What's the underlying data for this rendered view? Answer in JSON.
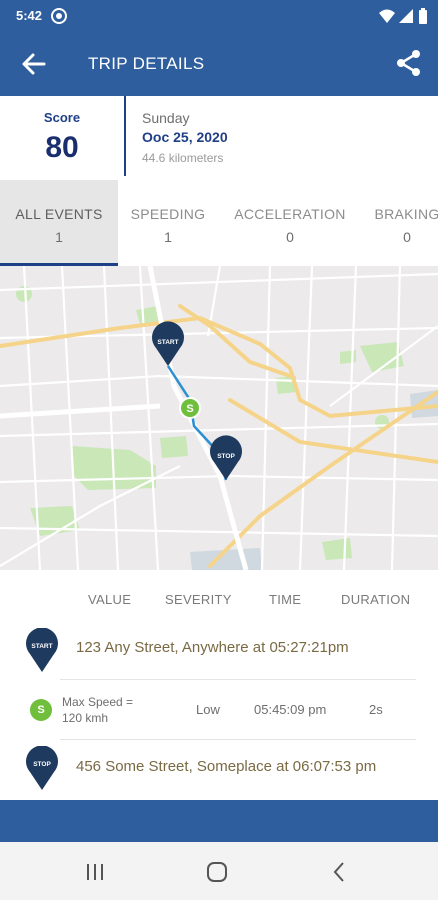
{
  "status_bar": {
    "time": "5:42"
  },
  "app_bar": {
    "title": "TRIP DETAILS"
  },
  "summary": {
    "score_label": "Score",
    "score_value": "80",
    "day": "Sunday",
    "date": "Ooc 25, 2020",
    "distance": "44.6 kilometers"
  },
  "tabs": [
    {
      "label": "ALL EVENTS",
      "count": "1",
      "active": true
    },
    {
      "label": "SPEEDING",
      "count": "1"
    },
    {
      "label": "ACCELERATION",
      "count": "0"
    },
    {
      "label": "BRAKING",
      "count": "0"
    }
  ],
  "map": {
    "start_label": "START",
    "stop_label": "STOP",
    "speed_marker_label": "S",
    "route_color": "#2c8fd1",
    "pin_color": "#1f3a5f"
  },
  "table": {
    "columns": [
      "VALUE",
      "SEVERITY",
      "TIME",
      "DURATION"
    ],
    "start_row": {
      "pin_label": "START",
      "address": "123 Any Street, Anywhere at 05:27:21pm"
    },
    "event_row": {
      "icon_label": "S",
      "value": "Max Speed = 120 kmh",
      "value_line1": "Max Speed =",
      "value_line2": "120 kmh",
      "severity": "Low",
      "time": "05:45:09 pm",
      "duration": "2s"
    },
    "stop_row": {
      "pin_label": "STOP",
      "address": "456 Some Street, Someplace at 06:07:53 pm"
    }
  },
  "colors": {
    "primary": "#2e5e9e",
    "score_text": "#1a2d6e",
    "address_text": "#7a6a44",
    "speed_green": "#6fbf3c"
  }
}
